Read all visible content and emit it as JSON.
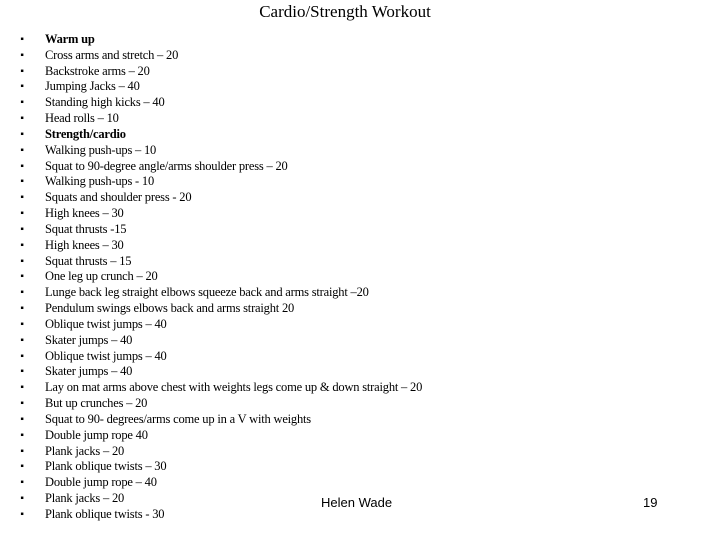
{
  "page": {
    "title": "Cardio/Strength Workout"
  },
  "bullet_glyph": "▪",
  "items": [
    {
      "text": "Warm up",
      "heading": true
    },
    {
      "text": "Cross arms and stretch – 20",
      "heading": false
    },
    {
      "text": "Backstroke arms – 20",
      "heading": false
    },
    {
      "text": "Jumping Jacks – 40",
      "heading": false
    },
    {
      "text": "Standing high kicks – 40",
      "heading": false
    },
    {
      "text": "Head rolls – 10",
      "heading": false
    },
    {
      "text": "Strength/cardio",
      "heading": true
    },
    {
      "text": "Walking push-ups – 10",
      "heading": false
    },
    {
      "text": "Squat to 90-degree angle/arms shoulder press – 20",
      "heading": false
    },
    {
      "text": "Walking push-ups - 10",
      "heading": false
    },
    {
      "text": "Squats and shoulder press - 20",
      "heading": false
    },
    {
      "text": "High knees – 30",
      "heading": false
    },
    {
      "text": "Squat thrusts -15",
      "heading": false
    },
    {
      "text": "High knees – 30",
      "heading": false
    },
    {
      "text": "Squat thrusts – 15",
      "heading": false
    },
    {
      "text": "One leg up crunch – 20",
      "heading": false
    },
    {
      "text": "Lunge back leg straight elbows squeeze back and arms straight –20",
      "heading": false
    },
    {
      "text": "Pendulum swings elbows back and arms straight 20",
      "heading": false
    },
    {
      "text": "Oblique twist jumps – 40",
      "heading": false
    },
    {
      "text": "Skater jumps – 40",
      "heading": false
    },
    {
      "text": "Oblique twist jumps – 40",
      "heading": false
    },
    {
      "text": "Skater jumps – 40",
      "heading": false
    },
    {
      "text": "Lay on mat arms above chest with weights legs come up & down straight – 20",
      "heading": false
    },
    {
      "text": "But up crunches – 20",
      "heading": false
    },
    {
      "text": "Squat to 90- degrees/arms come up in a V with weights",
      "heading": false
    },
    {
      "text": "Double jump rope 40",
      "heading": false
    },
    {
      "text": "Plank jacks – 20",
      "heading": false
    },
    {
      "text": "Plank oblique twists – 30",
      "heading": false
    },
    {
      "text": "Double jump rope – 40",
      "heading": false
    },
    {
      "text": "Plank jacks – 20",
      "heading": false
    },
    {
      "text": "Plank oblique twists - 30",
      "heading": false
    }
  ],
  "footer": {
    "author": "Helen Wade",
    "page_number": "19"
  }
}
